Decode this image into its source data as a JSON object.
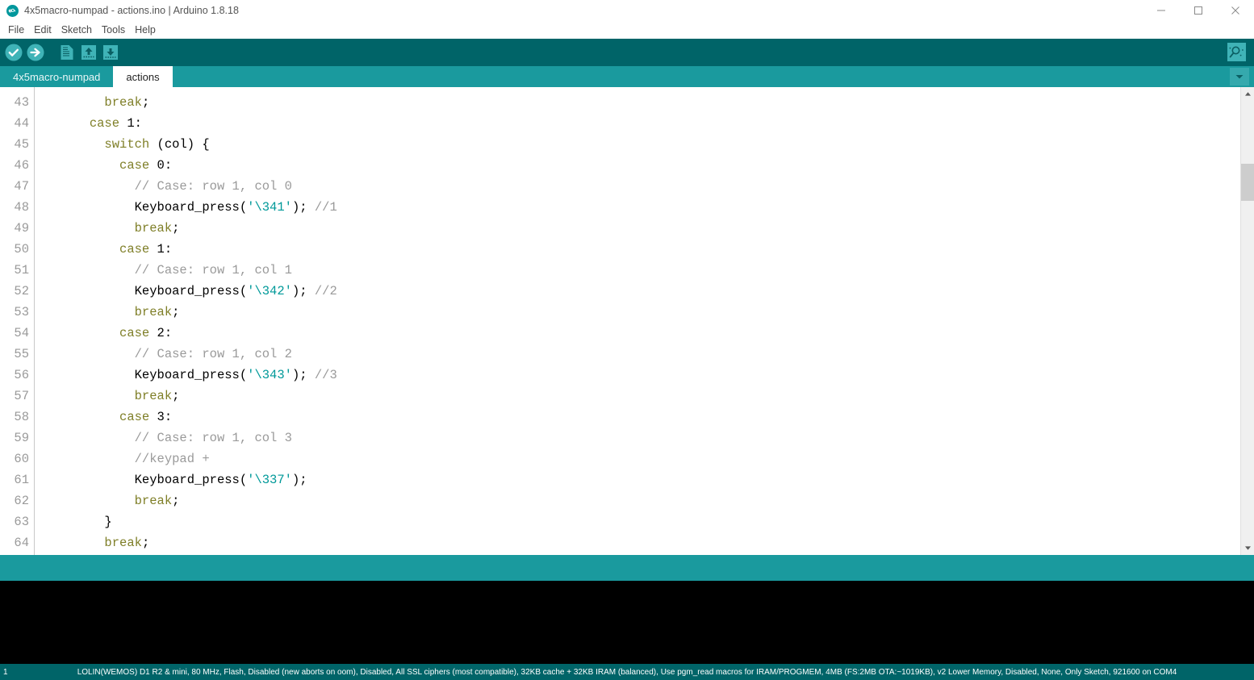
{
  "window": {
    "title": "4x5macro-numpad - actions.ino | Arduino 1.8.18",
    "logo_icon": "arduino-infinity-logo",
    "minimize_icon": "minimize-icon",
    "maximize_icon": "maximize-icon",
    "close_icon": "close-icon"
  },
  "menubar": {
    "items": [
      {
        "label": "File"
      },
      {
        "label": "Edit"
      },
      {
        "label": "Sketch"
      },
      {
        "label": "Tools"
      },
      {
        "label": "Help"
      }
    ]
  },
  "toolbar": {
    "verify_label": "Verify",
    "upload_label": "Upload",
    "new_label": "New",
    "open_label": "Open",
    "save_label": "Save",
    "serial_monitor_label": "Serial Monitor",
    "colors": {
      "background": "#006468",
      "icon": "#4fc3c6"
    }
  },
  "tabs": {
    "items": [
      {
        "label": "4x5macro-numpad",
        "active": false
      },
      {
        "label": "actions",
        "active": true
      }
    ],
    "menu_icon": "chevron-down-icon"
  },
  "editor": {
    "first_line_number": 43,
    "lines": [
      {
        "num": "43",
        "tokens": [
          {
            "t": "        ",
            "c": "pl"
          },
          {
            "t": "break",
            "c": "kw"
          },
          {
            "t": ";",
            "c": "pl"
          }
        ]
      },
      {
        "num": "44",
        "tokens": [
          {
            "t": "      ",
            "c": "pl"
          },
          {
            "t": "case",
            "c": "kw"
          },
          {
            "t": " 1:",
            "c": "pl"
          }
        ]
      },
      {
        "num": "45",
        "tokens": [
          {
            "t": "        ",
            "c": "pl"
          },
          {
            "t": "switch",
            "c": "kw"
          },
          {
            "t": " (col) {",
            "c": "pl"
          }
        ]
      },
      {
        "num": "46",
        "tokens": [
          {
            "t": "          ",
            "c": "pl"
          },
          {
            "t": "case",
            "c": "kw"
          },
          {
            "t": " 0:",
            "c": "pl"
          }
        ]
      },
      {
        "num": "47",
        "tokens": [
          {
            "t": "            ",
            "c": "pl"
          },
          {
            "t": "// Case: row 1, col 0",
            "c": "com"
          }
        ]
      },
      {
        "num": "48",
        "tokens": [
          {
            "t": "            ",
            "c": "pl"
          },
          {
            "t": "Keyboard_press(",
            "c": "fn"
          },
          {
            "t": "'\\341'",
            "c": "str"
          },
          {
            "t": "); ",
            "c": "pl"
          },
          {
            "t": "//1",
            "c": "com"
          }
        ]
      },
      {
        "num": "49",
        "tokens": [
          {
            "t": "            ",
            "c": "pl"
          },
          {
            "t": "break",
            "c": "kw"
          },
          {
            "t": ";",
            "c": "pl"
          }
        ]
      },
      {
        "num": "50",
        "tokens": [
          {
            "t": "          ",
            "c": "pl"
          },
          {
            "t": "case",
            "c": "kw"
          },
          {
            "t": " 1:",
            "c": "pl"
          }
        ]
      },
      {
        "num": "51",
        "tokens": [
          {
            "t": "            ",
            "c": "pl"
          },
          {
            "t": "// Case: row 1, col 1",
            "c": "com"
          }
        ]
      },
      {
        "num": "52",
        "tokens": [
          {
            "t": "            ",
            "c": "pl"
          },
          {
            "t": "Keyboard_press(",
            "c": "fn"
          },
          {
            "t": "'\\342'",
            "c": "str"
          },
          {
            "t": "); ",
            "c": "pl"
          },
          {
            "t": "//2",
            "c": "com"
          }
        ]
      },
      {
        "num": "53",
        "tokens": [
          {
            "t": "            ",
            "c": "pl"
          },
          {
            "t": "break",
            "c": "kw"
          },
          {
            "t": ";",
            "c": "pl"
          }
        ]
      },
      {
        "num": "54",
        "tokens": [
          {
            "t": "          ",
            "c": "pl"
          },
          {
            "t": "case",
            "c": "kw"
          },
          {
            "t": " 2:",
            "c": "pl"
          }
        ]
      },
      {
        "num": "55",
        "tokens": [
          {
            "t": "            ",
            "c": "pl"
          },
          {
            "t": "// Case: row 1, col 2",
            "c": "com"
          }
        ]
      },
      {
        "num": "56",
        "tokens": [
          {
            "t": "            ",
            "c": "pl"
          },
          {
            "t": "Keyboard_press(",
            "c": "fn"
          },
          {
            "t": "'\\343'",
            "c": "str"
          },
          {
            "t": "); ",
            "c": "pl"
          },
          {
            "t": "//3",
            "c": "com"
          }
        ]
      },
      {
        "num": "57",
        "tokens": [
          {
            "t": "            ",
            "c": "pl"
          },
          {
            "t": "break",
            "c": "kw"
          },
          {
            "t": ";",
            "c": "pl"
          }
        ]
      },
      {
        "num": "58",
        "tokens": [
          {
            "t": "          ",
            "c": "pl"
          },
          {
            "t": "case",
            "c": "kw"
          },
          {
            "t": " 3:",
            "c": "pl"
          }
        ]
      },
      {
        "num": "59",
        "tokens": [
          {
            "t": "            ",
            "c": "pl"
          },
          {
            "t": "// Case: row 1, col 3",
            "c": "com"
          }
        ]
      },
      {
        "num": "60",
        "tokens": [
          {
            "t": "            ",
            "c": "pl"
          },
          {
            "t": "//keypad +",
            "c": "com"
          }
        ]
      },
      {
        "num": "61",
        "tokens": [
          {
            "t": "            ",
            "c": "pl"
          },
          {
            "t": "Keyboard_press(",
            "c": "fn"
          },
          {
            "t": "'\\337'",
            "c": "str"
          },
          {
            "t": ");",
            "c": "pl"
          }
        ]
      },
      {
        "num": "62",
        "tokens": [
          {
            "t": "            ",
            "c": "pl"
          },
          {
            "t": "break",
            "c": "kw"
          },
          {
            "t": ";",
            "c": "pl"
          }
        ]
      },
      {
        "num": "63",
        "tokens": [
          {
            "t": "        ",
            "c": "pl"
          },
          {
            "t": "}",
            "c": "pl"
          }
        ]
      },
      {
        "num": "64",
        "tokens": [
          {
            "t": "        ",
            "c": "pl"
          },
          {
            "t": "break",
            "c": "kw"
          },
          {
            "t": ";",
            "c": "pl"
          }
        ]
      }
    ],
    "scrollbar": {
      "up_icon": "scroll-up-arrow-icon",
      "down_icon": "scroll-down-arrow-icon"
    }
  },
  "message_bar": {
    "text": ""
  },
  "console": {
    "text": ""
  },
  "statusbar": {
    "line_number": "1",
    "board_info": "LOLIN(WEMOS) D1 R2 & mini, 80 MHz, Flash, Disabled (new aborts on oom), Disabled, All SSL ciphers (most compatible), 32KB cache + 32KB IRAM (balanced), Use pgm_read macros for IRAM/PROGMEM, 4MB (FS:2MB OTA:~1019KB), v2 Lower Memory, Disabled, None, Only Sketch, 921600 on COM4"
  }
}
